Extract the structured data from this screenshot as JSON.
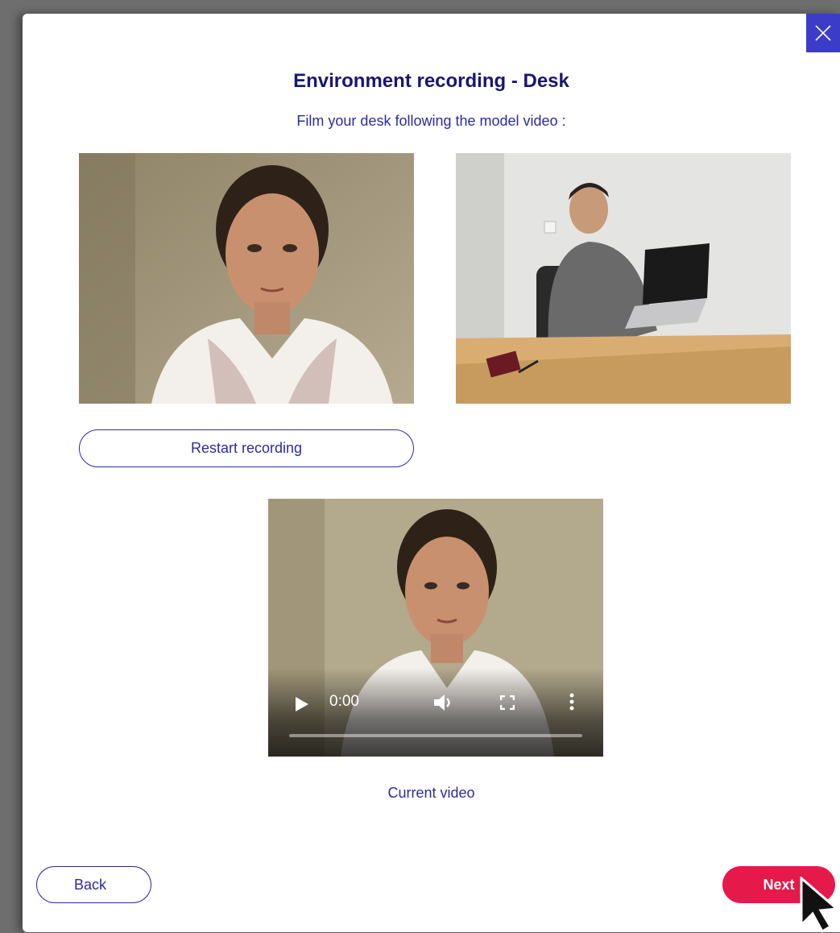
{
  "modal": {
    "title": "Environment recording - Desk",
    "subtitle": "Film your desk following the model video :",
    "close_icon": "close-icon"
  },
  "media": {
    "user_recording": "user-recording-preview",
    "model_video": "model-video-preview"
  },
  "buttons": {
    "restart_label": "Restart recording",
    "back_label": "Back",
    "next_label": "Next"
  },
  "current_video": {
    "time": "0:00",
    "progress": 0,
    "caption": "Current video",
    "controls": [
      "play-icon",
      "volume-icon",
      "fullscreen-icon",
      "more-icon"
    ]
  },
  "colors": {
    "primary": "#2e2aa0",
    "title": "#1a1670",
    "accent": "#e6194b",
    "close_bg": "#3b3dc8"
  }
}
